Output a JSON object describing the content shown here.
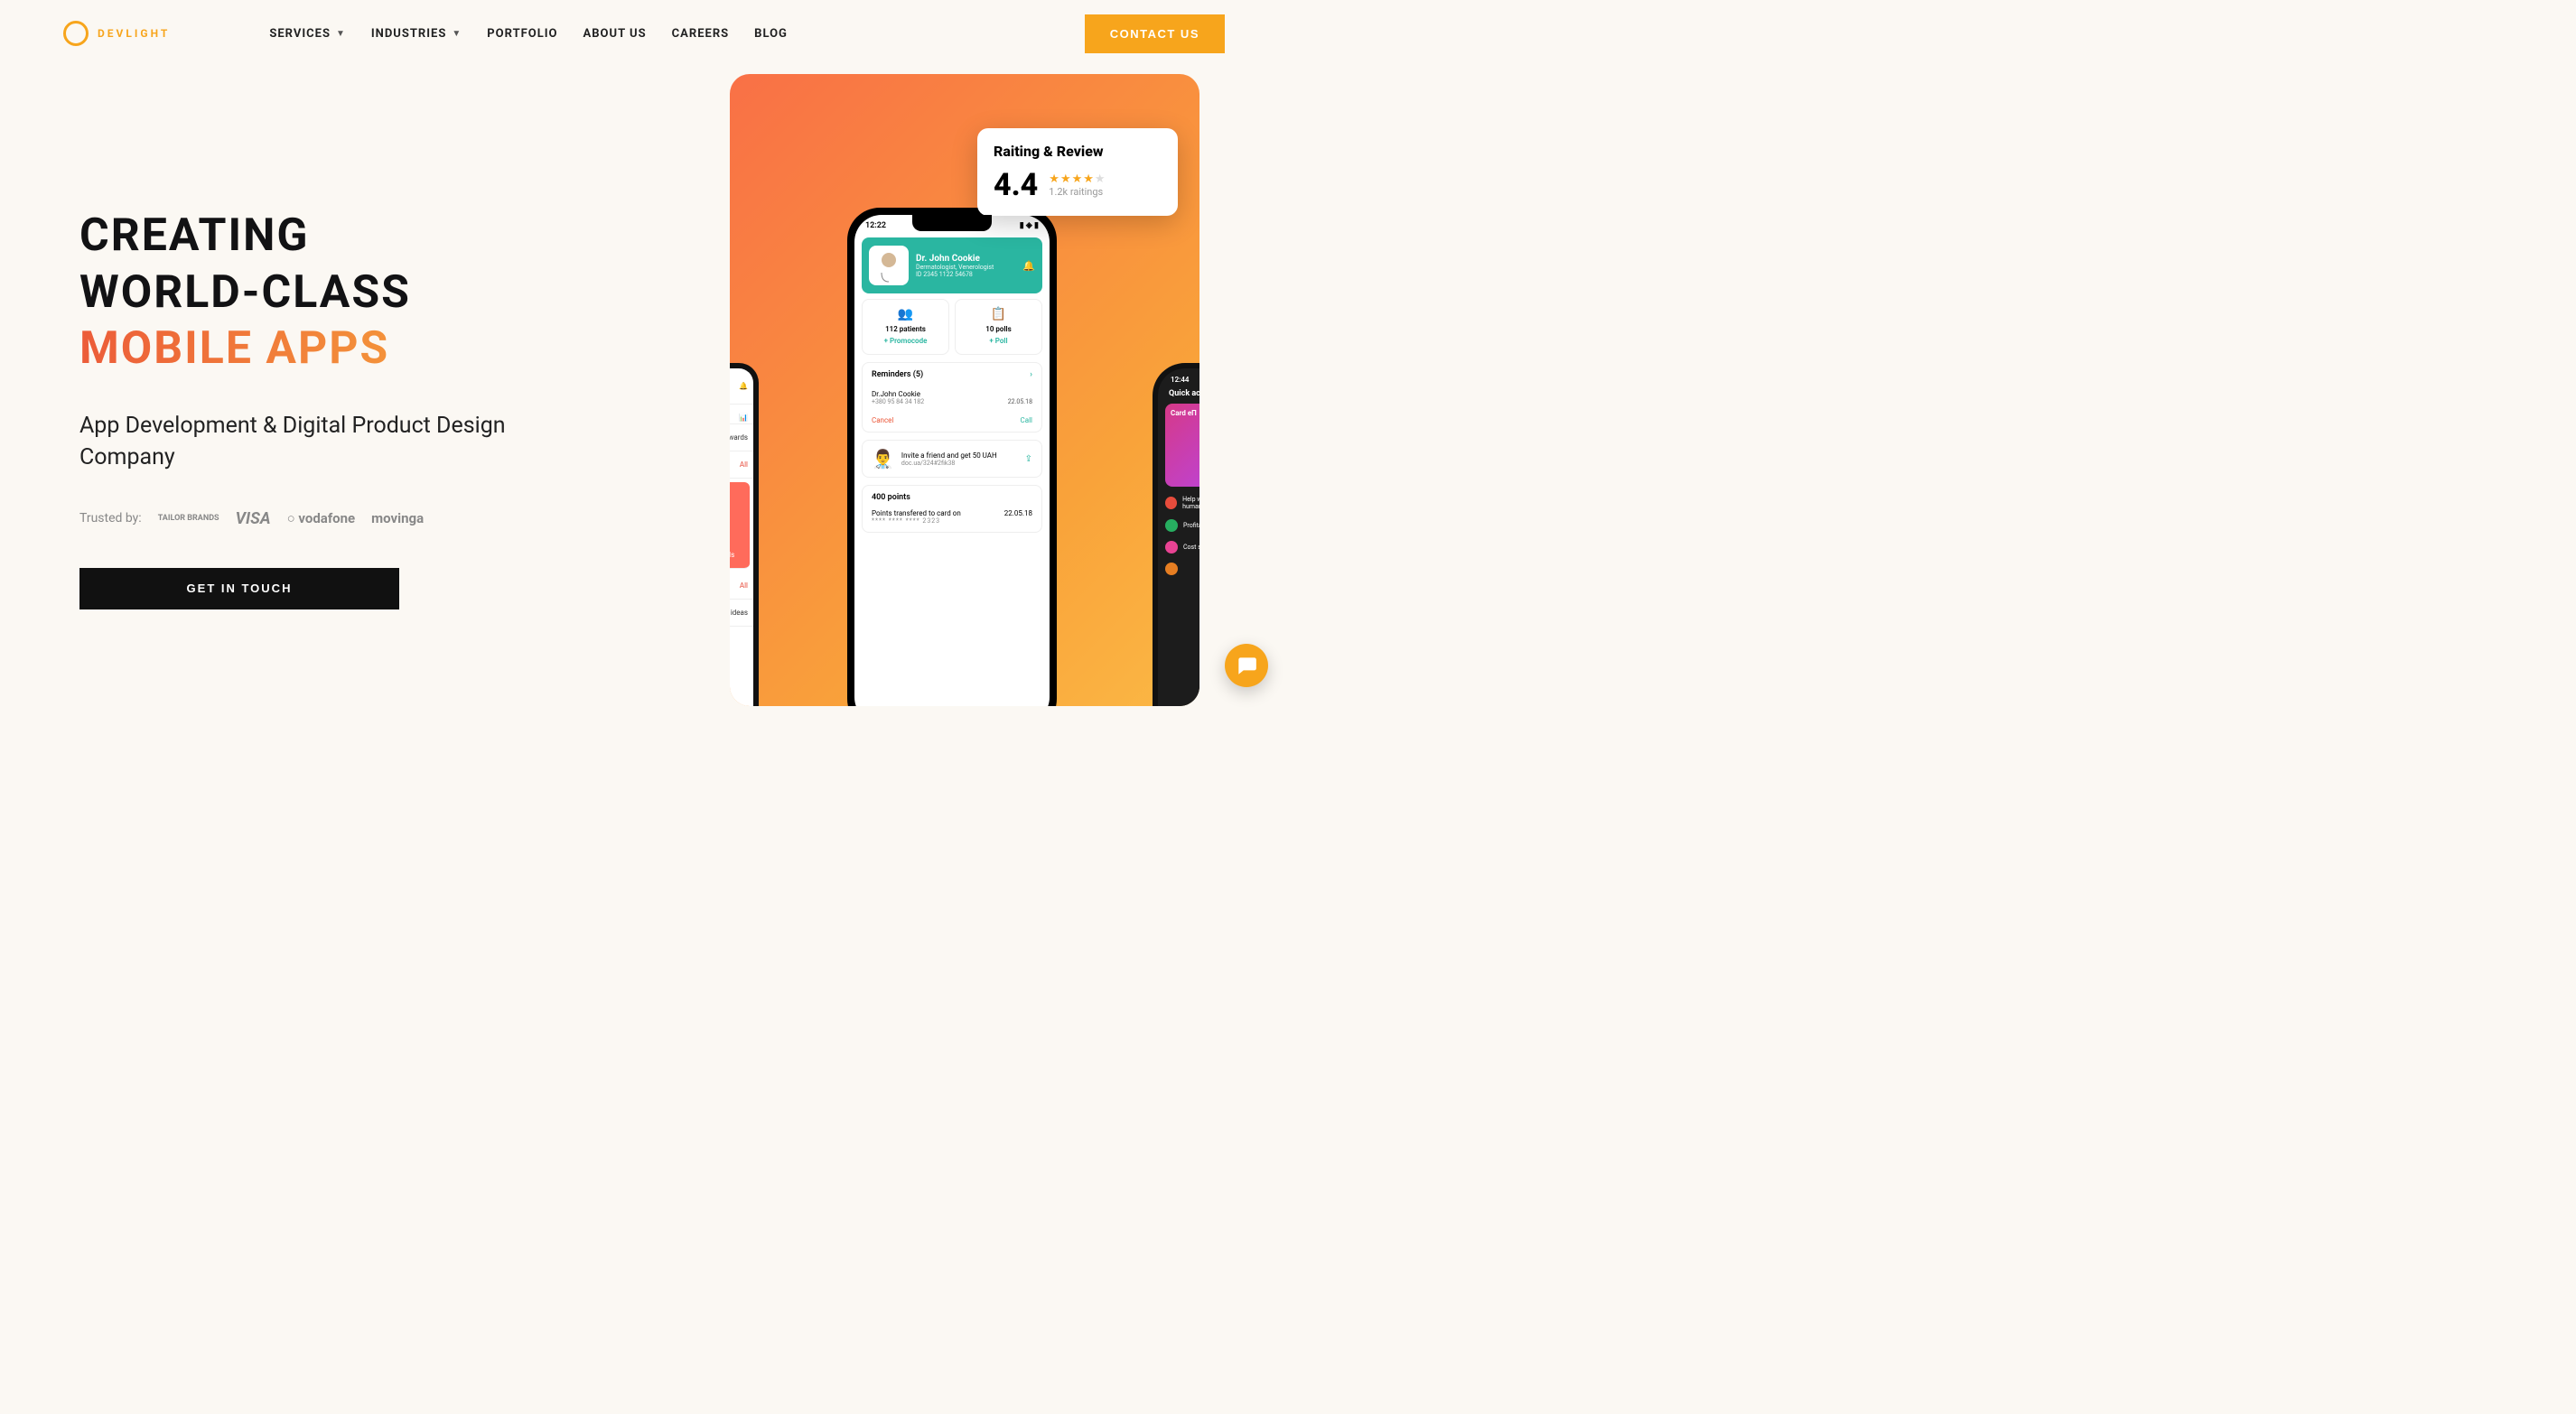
{
  "brand": "DEVLIGHT",
  "nav": {
    "services": "SERVICES",
    "industries": "INDUSTRIES",
    "portfolio": "PORTFOLIO",
    "about": "ABOUT US",
    "careers": "CAREERS",
    "blog": "BLOG"
  },
  "contact_button": "CONTACT US",
  "hero": {
    "line1": "CREATING",
    "line2": "WORLD-CLASS",
    "line3": "MOBILE APPS",
    "subtitle": "App Development & Digital Product Design Company",
    "trusted_label": "Trusted by:",
    "cta": "GET IN TOUCH"
  },
  "trusted_brands": {
    "tailor": "TAILOR BRANDS",
    "visa": "VISA",
    "vodafone": "vodafone",
    "movinga": "movinga"
  },
  "rating": {
    "title": "Raiting & Review",
    "score": "4.4",
    "count": "1.2k raitings"
  },
  "phone": {
    "time": "12:22",
    "doctor_name": "Dr. John Cookie",
    "doctor_spec": "Dermatologist, Venerologist",
    "doctor_id": "ID 2345 1122 54678",
    "stat1_value": "112 patients",
    "stat1_action": "+  Promocode",
    "stat2_value": "10 polls",
    "stat2_action": "+  Poll",
    "reminders_title": "Reminders (5)",
    "rem_name": "Dr.John Cookie",
    "rem_phone": "+380 95 84 34 182",
    "rem_date": "22.05.18",
    "cancel": "Cancel",
    "call": "Call",
    "invite_text": "Invite a friend and get 50 UAH",
    "invite_link": "doc.ua/324#2fik38",
    "points": "400 points",
    "transfer_label": "Points transfered to card on",
    "transfer_date": "22.05.18",
    "card_mask": "**** **** **** 2323"
  },
  "peek": {
    "row1": "wards",
    "row2": "All",
    "row3": "Details",
    "row4": "All",
    "row5": "reat ideas"
  },
  "dark": {
    "time": "12:44",
    "quick": "Quick actio",
    "card": "Card eП",
    "item1": "Help with humanitarian...",
    "item2": "Profitable Safe",
    "item3": "Cost statistics"
  }
}
